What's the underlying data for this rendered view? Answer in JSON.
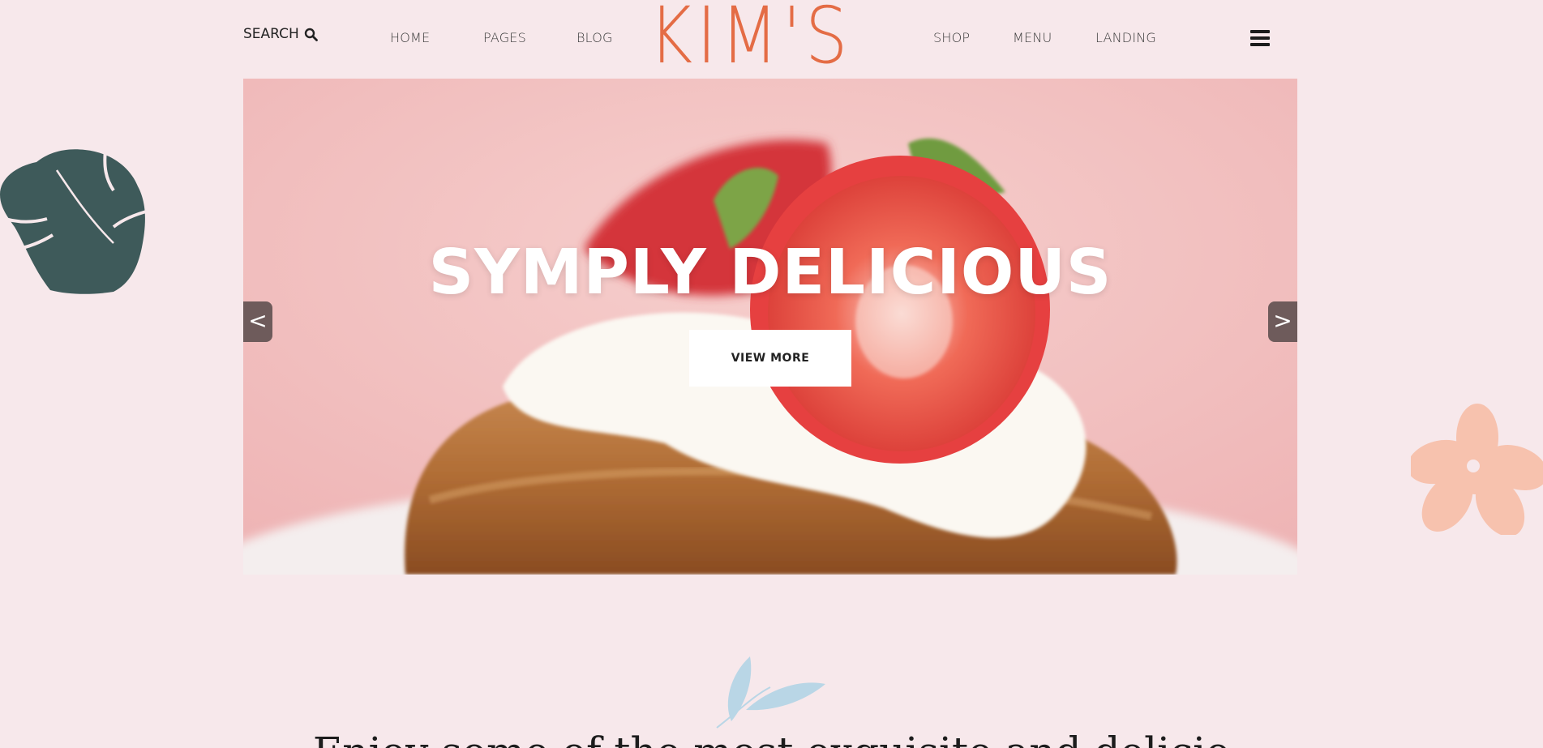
{
  "header": {
    "search_label": "SEARCH",
    "nav_left": [
      "HOME",
      "PAGES",
      "BLOG"
    ],
    "logo": "KIM'S",
    "nav_right": [
      "SHOP",
      "MENU",
      "LANDING"
    ]
  },
  "hero": {
    "title": "SYMPLY DELICIOUS",
    "button_label": "VIEW MORE",
    "prev_label": "<",
    "next_label": ">"
  },
  "intro": {
    "text": "Enjoy some of the most exquisite and delicio"
  },
  "colors": {
    "background": "#f7e8eb",
    "logo": "#e46c45",
    "leaf_dark": "#3e5a5a",
    "flower": "#f7c2ae",
    "leaf_blue": "#b9d6e6"
  },
  "icons": {
    "search": "search-icon",
    "menu": "hamburger-menu-icon",
    "monstera": "monstera-leaf-icon",
    "flower": "flower-icon",
    "sprig": "leaf-sprig-icon"
  }
}
